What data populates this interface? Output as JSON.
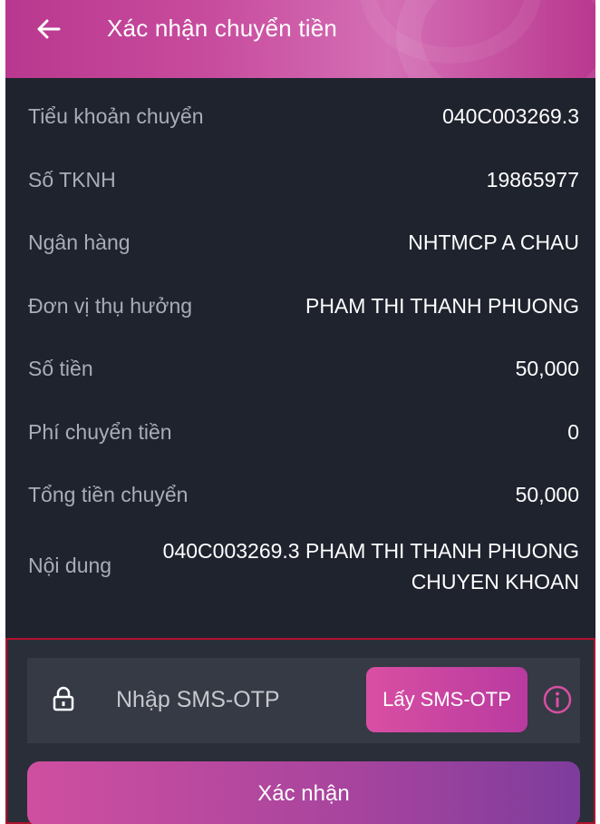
{
  "header": {
    "title": "Xác nhận chuyển tiền",
    "back_icon": "arrow-left-icon"
  },
  "details": [
    {
      "label": "Tiểu khoản chuyển",
      "value": "040C003269.3"
    },
    {
      "label": "Số TKNH",
      "value": "19865977"
    },
    {
      "label": "Ngân hàng",
      "value": "NHTMCP A CHAU"
    },
    {
      "label": "Đơn vị thụ hưởng",
      "value": "PHAM THI THANH PHUONG"
    },
    {
      "label": "Số tiền",
      "value": "50,000"
    },
    {
      "label": "Phí chuyển tiền",
      "value": "0"
    },
    {
      "label": "Tổng tiền chuyển",
      "value": "50,000"
    },
    {
      "label": "Nội dung",
      "value": "040C003269.3 PHAM THI THANH PHUONG CHUYEN KHOAN"
    }
  ],
  "otp": {
    "placeholder": "Nhập SMS-OTP",
    "value": "",
    "get_otp_label": "Lấy SMS-OTP",
    "lock_icon": "lock-icon",
    "info_icon": "info-icon"
  },
  "confirm_label": "Xác nhận",
  "colors": {
    "header_start": "#b9388f",
    "header_end": "#d46fb5",
    "background": "#1f232e",
    "accent": "#d94fa3",
    "error_border": "#b0122e"
  }
}
